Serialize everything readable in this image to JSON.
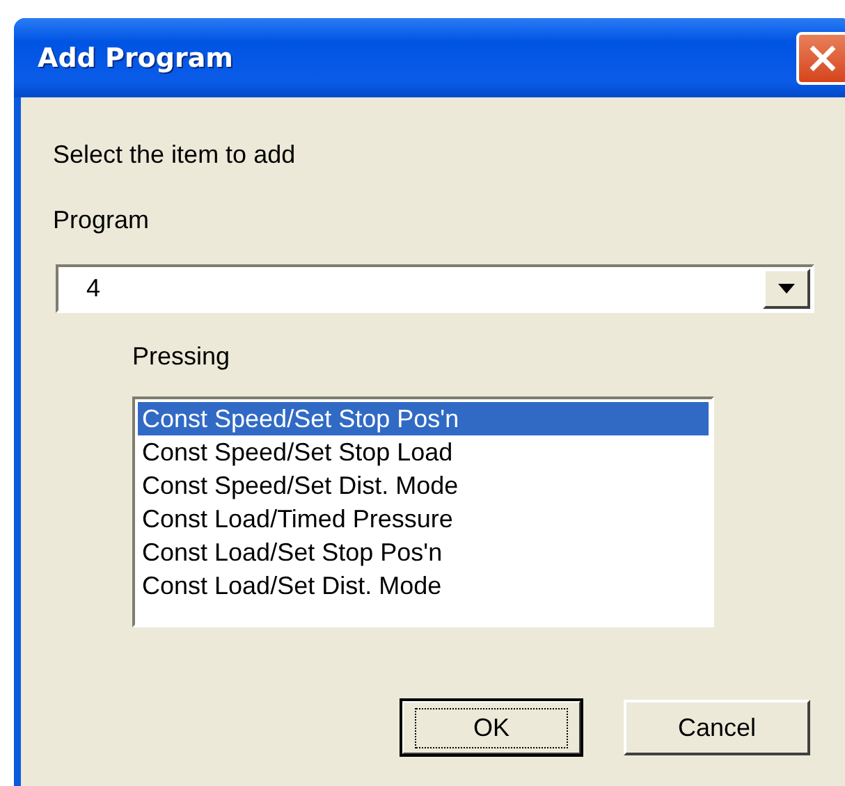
{
  "window": {
    "title": "Add Program"
  },
  "instruction": "Select the item to add",
  "program": {
    "label": "Program",
    "value": "4"
  },
  "pressing": {
    "label": "Pressing",
    "items": [
      {
        "label": "Const Speed/Set Stop Pos'n",
        "selected": true
      },
      {
        "label": "Const Speed/Set Stop Load",
        "selected": false
      },
      {
        "label": "Const Speed/Set Dist. Mode",
        "selected": false
      },
      {
        "label": "Const Load/Timed Pressure",
        "selected": false
      },
      {
        "label": "Const Load/Set Stop Pos'n",
        "selected": false
      },
      {
        "label": "Const Load/Set Dist. Mode",
        "selected": false
      }
    ]
  },
  "buttons": [
    {
      "label": "OK",
      "kind": "default"
    },
    {
      "label": "Cancel",
      "kind": "normal"
    }
  ]
}
